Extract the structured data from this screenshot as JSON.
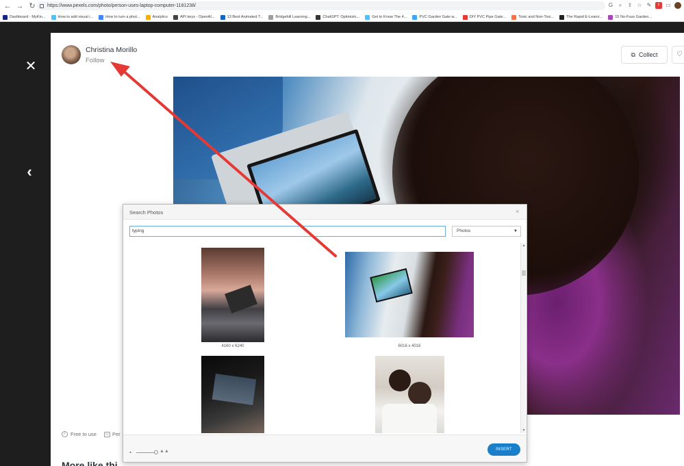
{
  "browser": {
    "url": "https://www.pexels.com/photo/person-uses-laptop-computer-1181238/",
    "bookmarks": [
      {
        "label": "Dashboard - MyKin...",
        "color": "#1a237e"
      },
      {
        "label": "How to add visual i...",
        "color": "#4fc3f7"
      },
      {
        "label": "How to turn a phot...",
        "color": "#4285f4"
      },
      {
        "label": "Analytics",
        "color": "#f9ab00"
      },
      {
        "label": "API keys - OpenAI...",
        "color": "#444444"
      },
      {
        "label": "13 Best Animated T...",
        "color": "#1565c0"
      },
      {
        "label": "Bridgehill Learning...",
        "color": "#9e9e9e"
      },
      {
        "label": "ChatGPT: Optimizin...",
        "color": "#333333"
      },
      {
        "label": "Get to Know The 4...",
        "color": "#4fc3f7"
      },
      {
        "label": "PVC Garden Gate w...",
        "color": "#42a5f5"
      },
      {
        "label": "DIY PVC Pipe Gate...",
        "color": "#e53935"
      },
      {
        "label": "Toxic and Non-Toxi...",
        "color": "#ff7043"
      },
      {
        "label": "The Rapid E-Learni...",
        "color": "#212121"
      },
      {
        "label": "15 No-Fuss Garden...",
        "color": "#ab47bc"
      }
    ]
  },
  "viewer": {
    "close_glyph": "✕",
    "prev_glyph": "‹",
    "author_name": "Christina Morillo",
    "follow_label": "Follow",
    "collect_label": "Collect",
    "free_to_use": "Free to use",
    "perm_label": "Per",
    "more_like_this": "More like thi"
  },
  "dialog": {
    "title": "Search Photos",
    "close_glyph": "×",
    "search_value": "typing",
    "type_select": "Photos",
    "results": [
      {
        "dims": "4160 x 6240"
      },
      {
        "dims": "6016 x 4016"
      },
      {
        "dims": ""
      },
      {
        "dims": ""
      }
    ],
    "insert_label": "INSERT"
  },
  "colors": {
    "arrow": "#e53935",
    "insert_button": "#1a7ec8",
    "search_focus": "#6aa9d8"
  }
}
